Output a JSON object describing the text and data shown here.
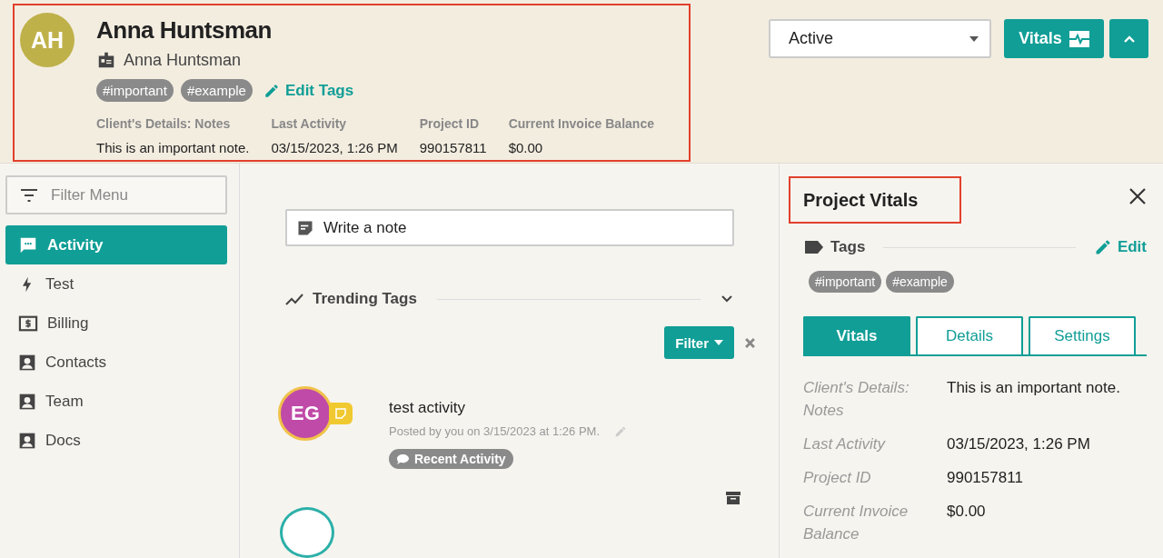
{
  "header": {
    "avatar_initials": "AH",
    "name": "Anna Huntsman",
    "account_name": "Anna Huntsman",
    "tags": [
      "#important",
      "#example"
    ],
    "edit_tags": "Edit Tags",
    "fields": [
      {
        "label": "Client's Details: Notes",
        "value": "This is an important note."
      },
      {
        "label": "Last Activity",
        "value": "03/15/2023, 1:26 PM"
      },
      {
        "label": "Project ID",
        "value": "990157811"
      },
      {
        "label": "Current Invoice Balance",
        "value": "$0.00"
      }
    ],
    "status": "Active",
    "vitals_button": "Vitals"
  },
  "sidebar": {
    "filter_placeholder": "Filter Menu",
    "items": [
      {
        "label": "Activity",
        "kind": "chat",
        "selected": true
      },
      {
        "label": "Test",
        "kind": "bolt",
        "selected": false
      },
      {
        "label": "Billing",
        "kind": "billing",
        "selected": false
      },
      {
        "label": "Contacts",
        "kind": "person",
        "selected": false
      },
      {
        "label": "Team",
        "kind": "person",
        "selected": false
      },
      {
        "label": "Docs",
        "kind": "person",
        "selected": false
      }
    ]
  },
  "feed": {
    "note_placeholder": "Write a note",
    "trending_title": "Trending Tags",
    "filter_button": "Filter",
    "activities": [
      {
        "initials": "EG",
        "title": "test activity",
        "meta": "Posted by you on 3/15/2023 at 1:26 PM.",
        "tag": "Recent Activity"
      }
    ]
  },
  "vitals_panel": {
    "title": "Project Vitals",
    "tags_label": "Tags",
    "edit": "Edit",
    "tags": [
      "#important",
      "#example"
    ],
    "tabs": [
      {
        "label": "Vitals",
        "selected": true
      },
      {
        "label": "Details",
        "selected": false
      },
      {
        "label": "Settings",
        "selected": false
      }
    ],
    "fields": [
      {
        "label": "Client's Details: Notes",
        "value": "This is an important note."
      },
      {
        "label": "Last Activity",
        "value": "03/15/2023, 1:26 PM"
      },
      {
        "label": "Project ID",
        "value": "990157811"
      },
      {
        "label": "Current Invoice Balance",
        "value": "$0.00"
      }
    ]
  }
}
